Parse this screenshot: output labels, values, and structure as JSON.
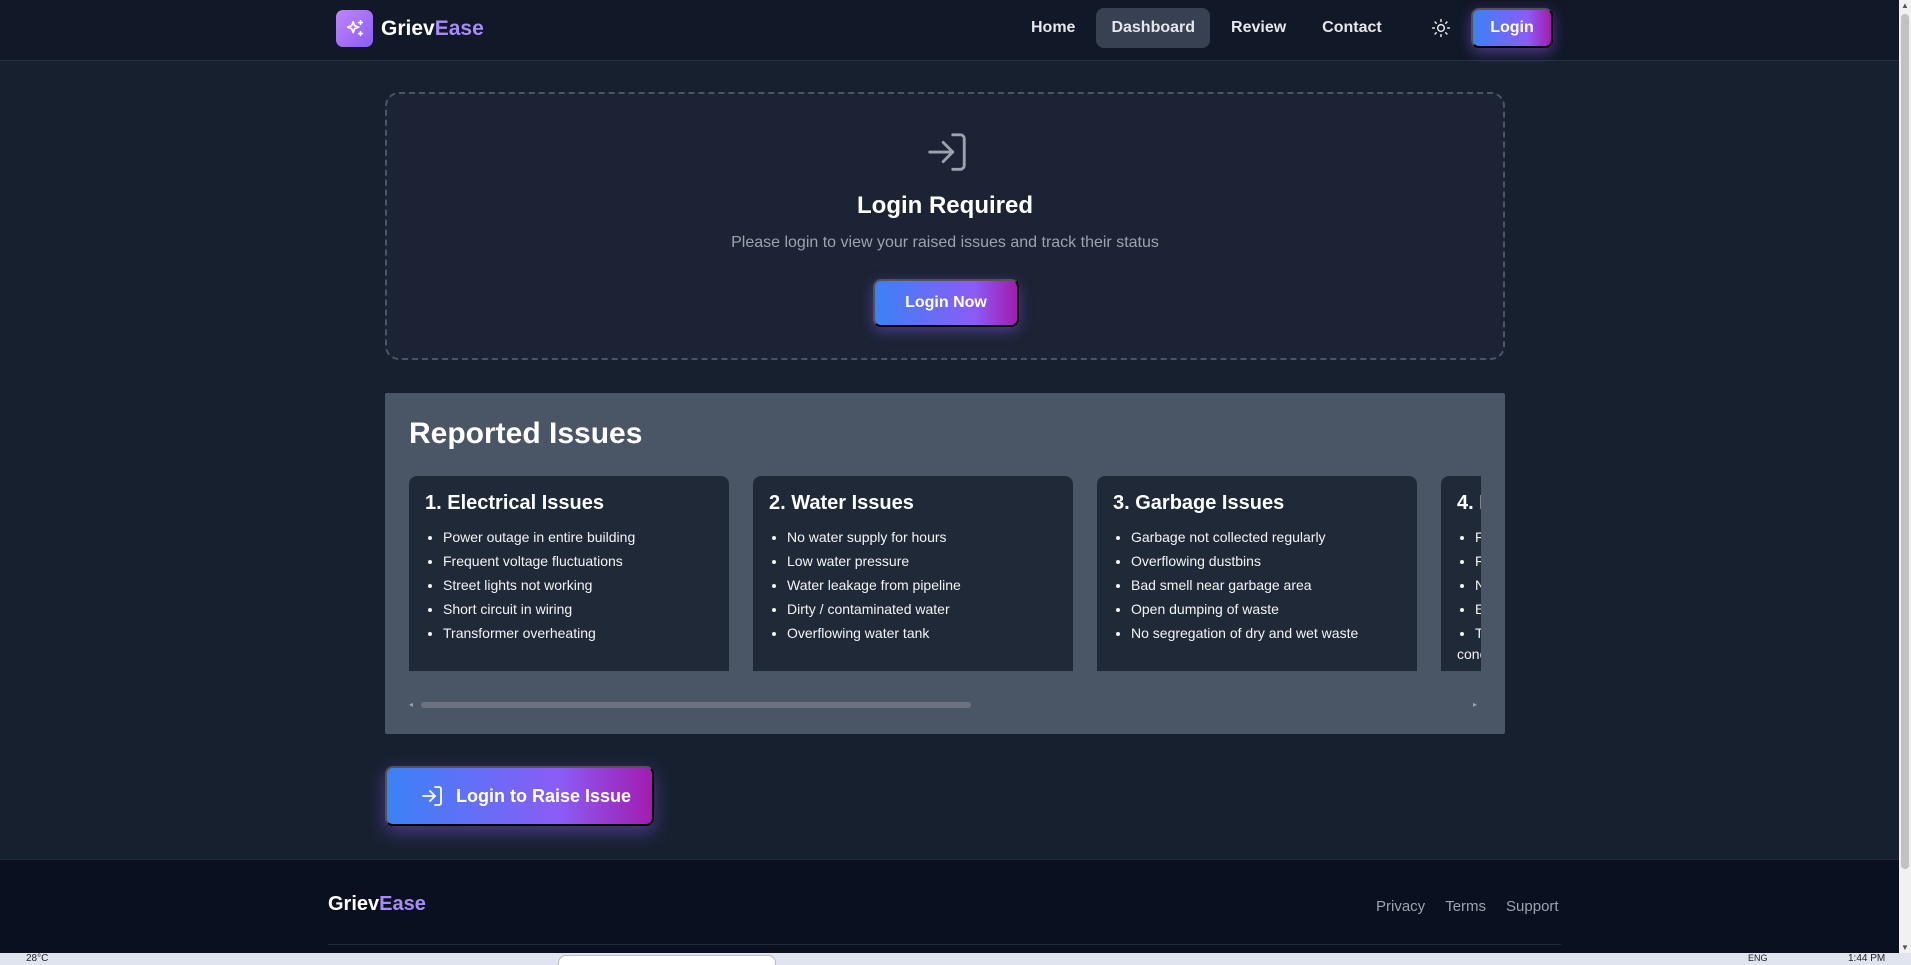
{
  "navbar": {
    "brand_main": "Griev",
    "brand_accent": "Ease",
    "links": [
      "Home",
      "Dashboard",
      "Review",
      "Contact"
    ],
    "active_link": "Dashboard",
    "login_label": "Login"
  },
  "login_card": {
    "title": "Login Required",
    "message": "Please login to view your raised issues and track their status",
    "button_label": "Login Now"
  },
  "issues": {
    "title": "Reported Issues",
    "cards": [
      {
        "title": "1. Electrical Issues",
        "items": [
          "Power outage in entire building",
          "Frequent voltage fluctuations",
          "Street lights not working",
          "Short circuit in wiring",
          "Transformer overheating"
        ]
      },
      {
        "title": "2. Water Issues",
        "items": [
          "No water supply for hours",
          "Low water pressure",
          "Water leakage from pipeline",
          "Dirty / contaminated water",
          "Overflowing water tank"
        ]
      },
      {
        "title": "3. Garbage Issues",
        "items": [
          "Garbage not collected regularly",
          "Overflowing dustbins",
          "Bad smell near garbage area",
          "Open dumping of waste",
          "No segregation of dry and wet waste"
        ]
      },
      {
        "title": "4. I",
        "items": [
          "F",
          "F",
          "N",
          "E",
          "T"
        ],
        "overflow_text": "conc"
      }
    ]
  },
  "raise_button_label": "Login to Raise Issue",
  "footer": {
    "brand_main": "Griev",
    "brand_accent": "Ease",
    "links": [
      "Privacy",
      "Terms",
      "Support"
    ]
  },
  "taskbar": {
    "weather": "28°C",
    "language": "ENG",
    "time": "1:44 PM"
  },
  "colors": {
    "background": "#17202f",
    "accent_gradient_start": "#3b82f6",
    "accent_gradient_end": "#a21caf",
    "brand_accent": "#a78bfa"
  }
}
